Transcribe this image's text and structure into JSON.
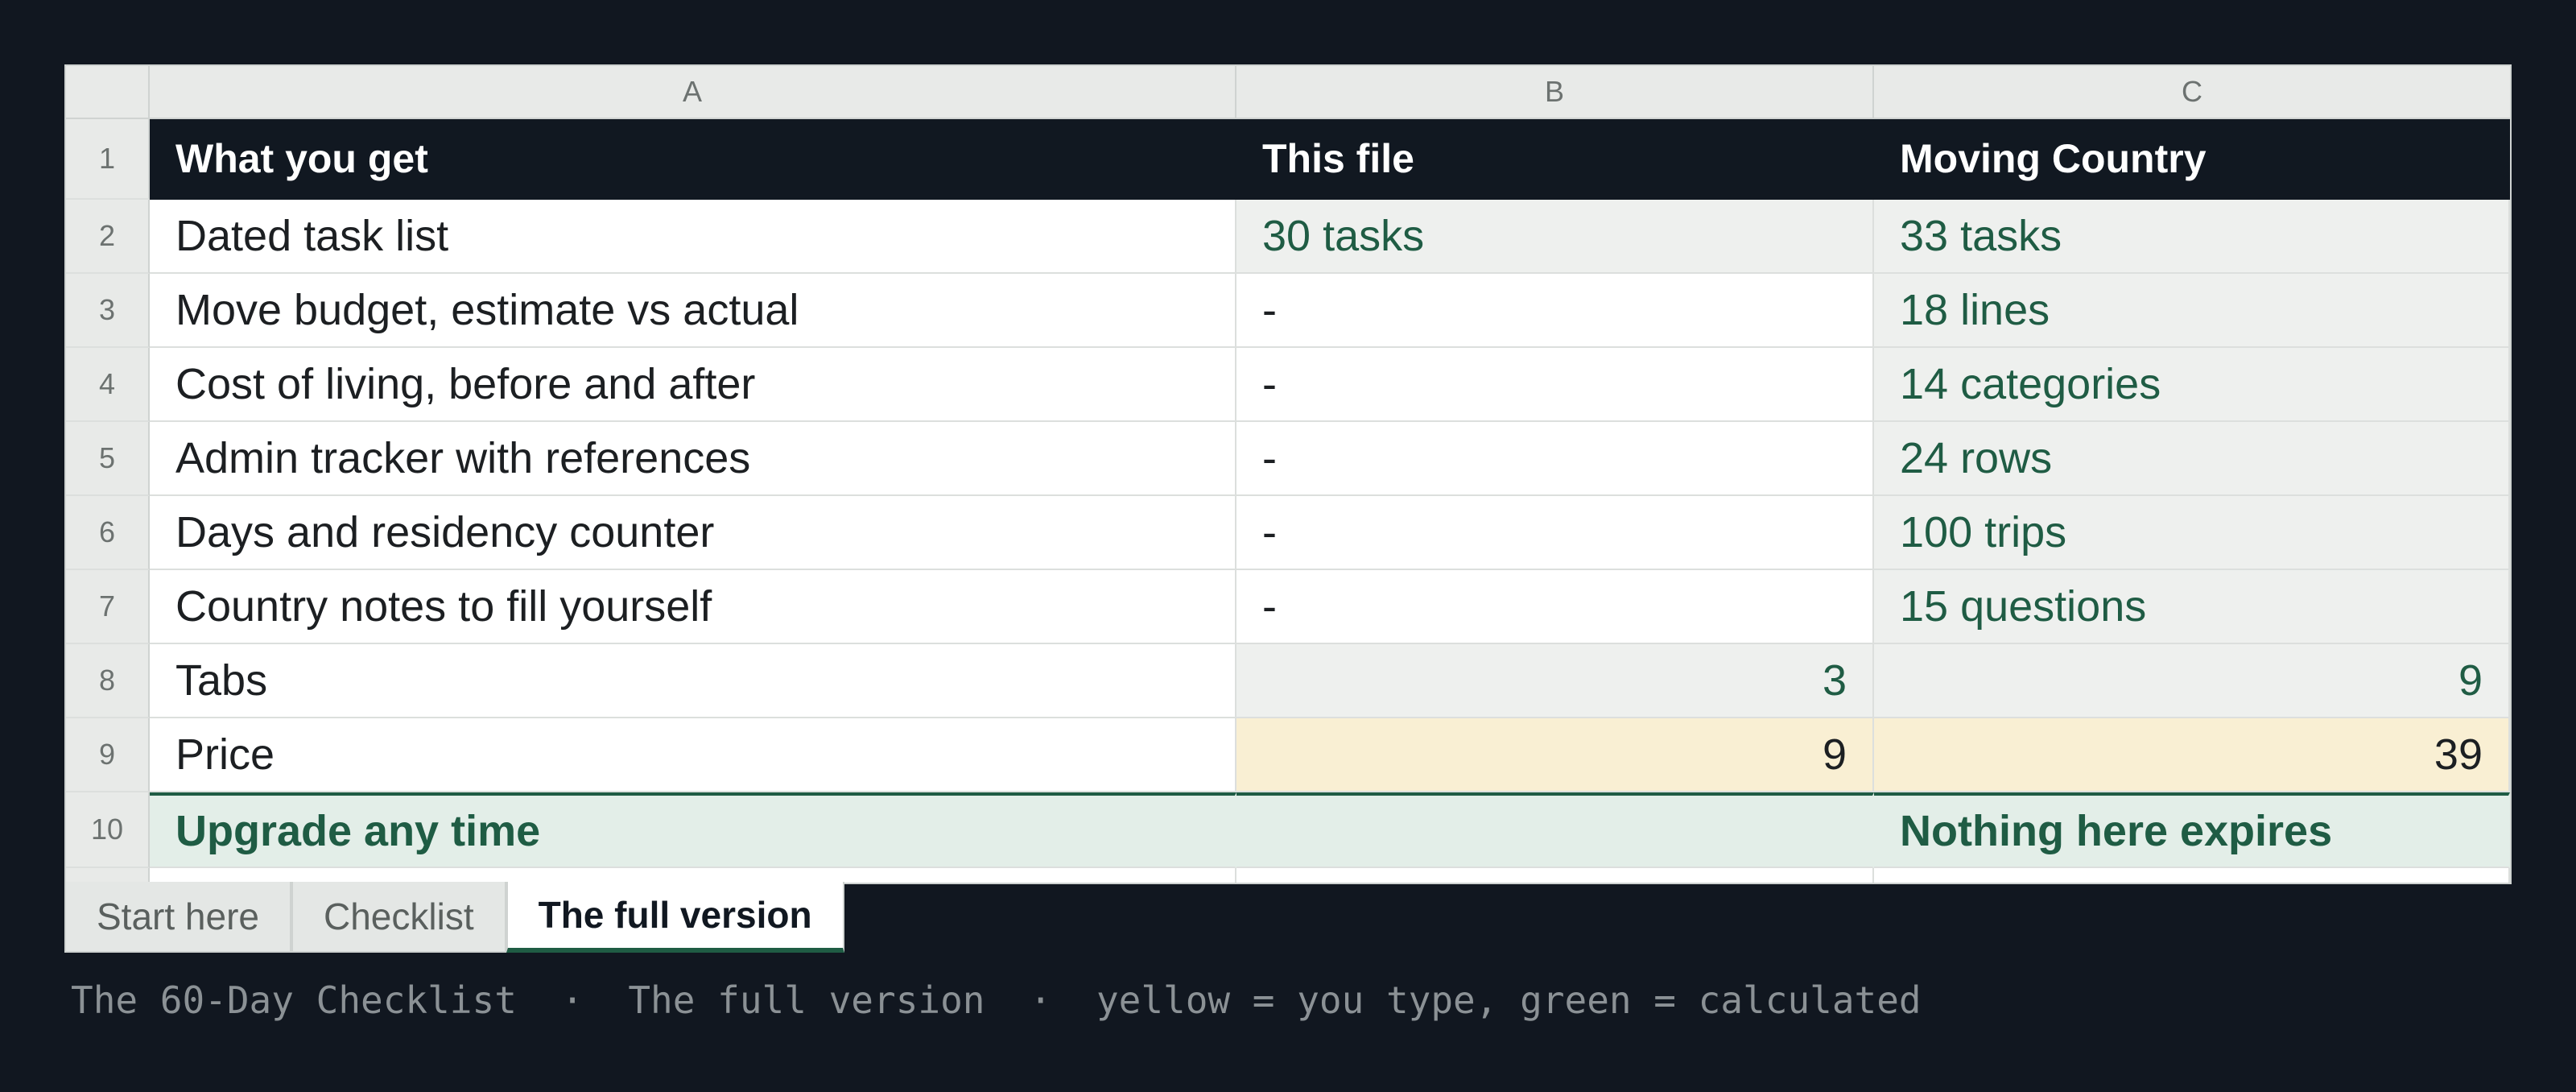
{
  "columns": [
    "A",
    "B",
    "C"
  ],
  "header": {
    "row": "1",
    "a": "What you get",
    "b": "This file",
    "c": "Moving Country"
  },
  "rows": [
    {
      "n": "2",
      "a": "Dated task list",
      "b": "30 tasks",
      "c": "33 tasks"
    },
    {
      "n": "3",
      "a": "Move budget, estimate vs actual",
      "b": "-",
      "c": "18 lines"
    },
    {
      "n": "4",
      "a": "Cost of living, before and after",
      "b": "-",
      "c": "14 categories"
    },
    {
      "n": "5",
      "a": "Admin tracker with references",
      "b": "-",
      "c": "24 rows"
    },
    {
      "n": "6",
      "a": "Days and residency counter",
      "b": "-",
      "c": "100 trips"
    },
    {
      "n": "7",
      "a": "Country notes to fill yourself",
      "b": "-",
      "c": "15 questions"
    },
    {
      "n": "8",
      "a": "Tabs",
      "b": "3",
      "c": "9"
    },
    {
      "n": "9",
      "a": "Price",
      "b": "9",
      "c": "39"
    }
  ],
  "footer": {
    "n": "10",
    "a": "Upgrade any time",
    "c": "Nothing here expires"
  },
  "tabs": [
    "Start here",
    "Checklist",
    "The full version"
  ],
  "active_tab": "The full version",
  "status_bar": "The 60-Day Checklist  ·  The full version  ·  yellow = you type, green = calculated",
  "colors": {
    "header_bg": "#111821",
    "calc_green": "#1f5c44",
    "input_yellow": "#f9efd3",
    "background": "#111720"
  }
}
